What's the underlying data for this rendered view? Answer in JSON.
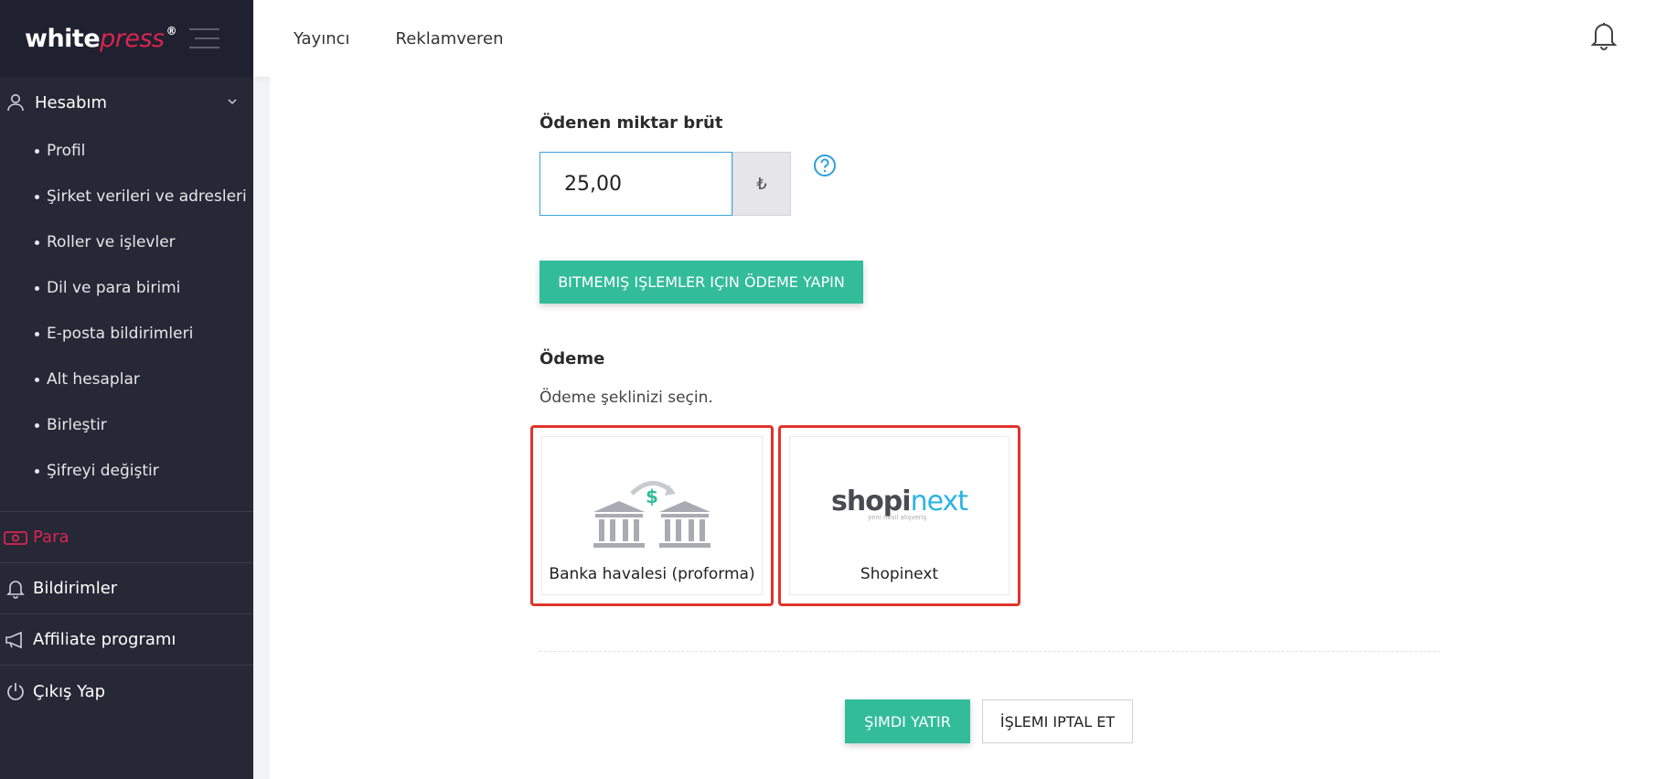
{
  "brand": {
    "logo_main": "white",
    "logo_accent": "press",
    "logo_reg": "®"
  },
  "header": {
    "links": [
      "Yayıncı",
      "Reklamveren"
    ]
  },
  "sidebar": {
    "account_title": "Hesabım",
    "sub_items": [
      "Profil",
      "Şirket verileri ve adresleri",
      "Roller ve işlevler",
      "Dil ve para birimi",
      "E-posta bildirimleri",
      "Alt hesaplar",
      "Birleştir",
      "Şifreyi değiştir"
    ],
    "money_label": "Para",
    "notifications_label": "Bildirimler",
    "affiliate_label": "Affiliate programı",
    "logout_label": "Çıkış Yap"
  },
  "form": {
    "amount_label": "Ödenen miktar brüt",
    "amount_value": "25,00",
    "currency_symbol": "₺",
    "pay_pending_label": "BITMEMIŞ IŞLEMLER IÇIN ÖDEME YAPIN",
    "payment_label": "Ödeme",
    "payment_subtext": "Ödeme şeklinizi seçin.",
    "methods": [
      {
        "label": "Banka havalesi (proforma)"
      },
      {
        "label": "Shopinext",
        "logo_main": "shopi",
        "logo_accent": "next",
        "tagline": "yeni nesil alışveriş"
      }
    ],
    "invest_button": "ŞIMDI YATIR",
    "cancel_button": "İŞLEMI IPTAL ET"
  },
  "colors": {
    "accent_red": "#d9254f",
    "primary_green": "#33bc9a",
    "highlight_red": "#e0342b",
    "sidebar_bg": "#262836"
  }
}
